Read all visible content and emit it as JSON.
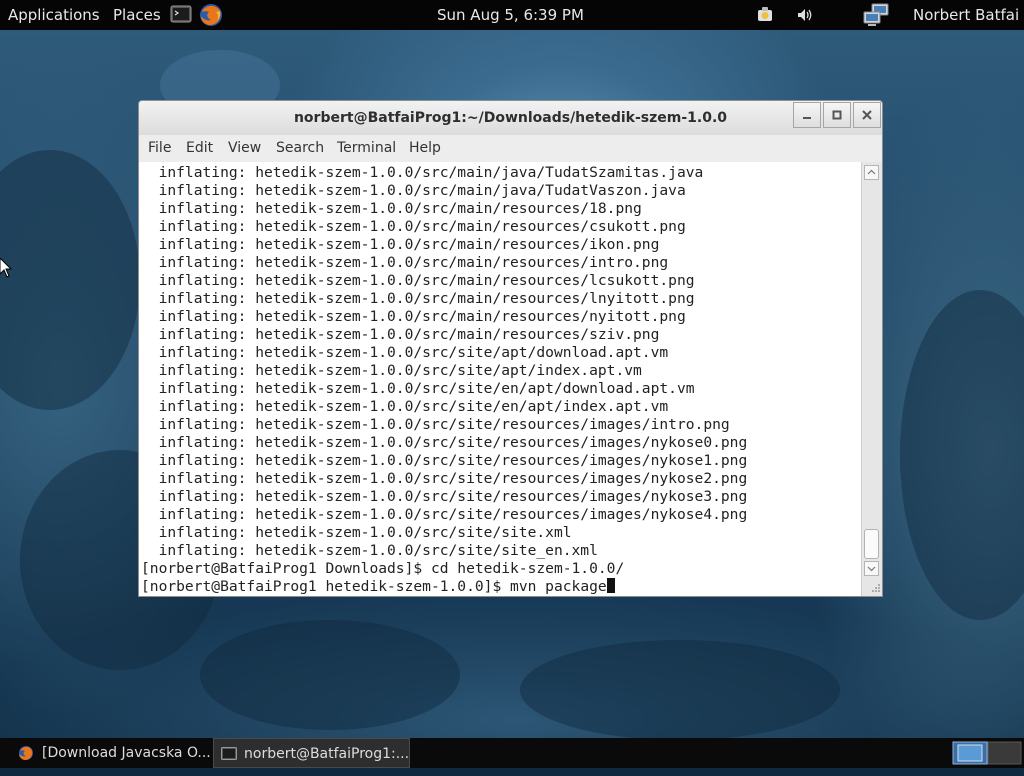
{
  "topbar": {
    "applications_label": "Applications",
    "places_label": "Places",
    "clock": "Sun Aug  5,  6:39 PM",
    "user_name": "Norbert Batfai"
  },
  "window": {
    "title": "norbert@BatfaiProg1:~/Downloads/hetedik-szem-1.0.0",
    "menus": [
      "File",
      "Edit",
      "View",
      "Search",
      "Terminal",
      "Help"
    ]
  },
  "terminal": {
    "lines": [
      "  inflating: hetedik-szem-1.0.0/src/main/java/TudatSzamitas.java",
      "  inflating: hetedik-szem-1.0.0/src/main/java/TudatVaszon.java",
      "  inflating: hetedik-szem-1.0.0/src/main/resources/18.png",
      "  inflating: hetedik-szem-1.0.0/src/main/resources/csukott.png",
      "  inflating: hetedik-szem-1.0.0/src/main/resources/ikon.png",
      "  inflating: hetedik-szem-1.0.0/src/main/resources/intro.png",
      "  inflating: hetedik-szem-1.0.0/src/main/resources/lcsukott.png",
      "  inflating: hetedik-szem-1.0.0/src/main/resources/lnyitott.png",
      "  inflating: hetedik-szem-1.0.0/src/main/resources/nyitott.png",
      "  inflating: hetedik-szem-1.0.0/src/main/resources/sziv.png",
      "  inflating: hetedik-szem-1.0.0/src/site/apt/download.apt.vm",
      "  inflating: hetedik-szem-1.0.0/src/site/apt/index.apt.vm",
      "  inflating: hetedik-szem-1.0.0/src/site/en/apt/download.apt.vm",
      "  inflating: hetedik-szem-1.0.0/src/site/en/apt/index.apt.vm",
      "  inflating: hetedik-szem-1.0.0/src/site/resources/images/intro.png",
      "  inflating: hetedik-szem-1.0.0/src/site/resources/images/nykose0.png",
      "  inflating: hetedik-szem-1.0.0/src/site/resources/images/nykose1.png",
      "  inflating: hetedik-szem-1.0.0/src/site/resources/images/nykose2.png",
      "  inflating: hetedik-szem-1.0.0/src/site/resources/images/nykose3.png",
      "  inflating: hetedik-szem-1.0.0/src/site/resources/images/nykose4.png",
      "  inflating: hetedik-szem-1.0.0/src/site/site.xml",
      "  inflating: hetedik-szem-1.0.0/src/site/site_en.xml",
      "[norbert@BatfaiProg1 Downloads]$ cd hetedik-szem-1.0.0/"
    ],
    "prompt": "[norbert@BatfaiProg1 hetedik-szem-1.0.0]$ ",
    "command": "mvn package"
  },
  "taskbar": {
    "tasks": [
      "[Download Javacska O...",
      "norbert@BatfaiProg1:..."
    ]
  },
  "icons": {
    "terminal": "terminal-icon",
    "firefox": "firefox-icon",
    "update": "update-notifier-icon",
    "volume": "volume-icon",
    "network": "network-icon",
    "workspace": "workspace-switcher-icon"
  },
  "colors": {
    "topbar_bg": "#050505",
    "terminal_bg": "#ffffff",
    "window_chrome": "#ededed",
    "workspace_active": "#5b9bd5"
  }
}
